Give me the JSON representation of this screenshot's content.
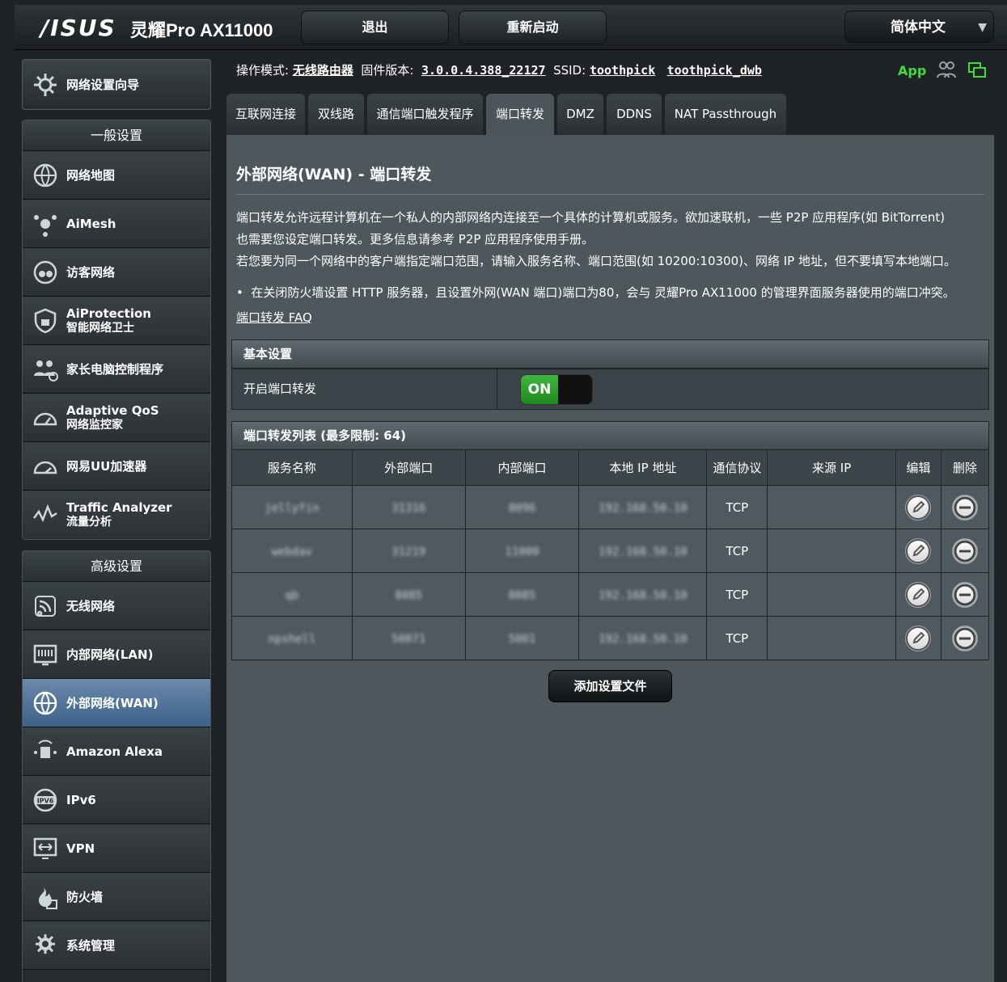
{
  "header": {
    "logo": "/ISUS",
    "model": "灵耀Pro AX11000",
    "logout_label": "退出",
    "reboot_label": "重新启动",
    "language": "简体中文"
  },
  "sidebar": {
    "quick_setup": "网络设置向导",
    "general_title": "一般设置",
    "general_items": [
      {
        "label": "网络地图",
        "sub": ""
      },
      {
        "label": "AiMesh",
        "sub": ""
      },
      {
        "label": "访客网络",
        "sub": ""
      },
      {
        "label": "AiProtection",
        "sub": "智能网络卫士"
      },
      {
        "label": "家长电脑控制程序",
        "sub": ""
      },
      {
        "label": "Adaptive QoS",
        "sub": "网络监控家"
      },
      {
        "label": "网易UU加速器",
        "sub": ""
      },
      {
        "label": "Traffic Analyzer",
        "sub": "流量分析"
      }
    ],
    "advanced_title": "高级设置",
    "advanced_items": [
      {
        "label": "无线网络"
      },
      {
        "label": "内部网络(LAN)"
      },
      {
        "label": "外部网络(WAN)"
      },
      {
        "label": "Amazon Alexa"
      },
      {
        "label": "IPv6"
      },
      {
        "label": "VPN"
      },
      {
        "label": "防火墙"
      },
      {
        "label": "系统管理"
      }
    ]
  },
  "infobar": {
    "mode_label": "操作模式:",
    "mode_value": "无线路由器",
    "fw_label": "固件版本:",
    "fw_value": "3.0.0.4.388_22127",
    "ssid_label": "SSID:",
    "ssid1": "toothpick",
    "ssid2": "toothpick_dwb",
    "app_label": "App"
  },
  "tabs": [
    "互联网连接",
    "双线路",
    "通信端口触发程序",
    "端口转发",
    "DMZ",
    "DDNS",
    "NAT Passthrough"
  ],
  "content": {
    "title": "外部网络(WAN) - 端口转发",
    "desc1": "端口转发允许远程计算机在一个私人的内部网络内连接至一个具体的计算机或服务。欲加速联机，一些 P2P 应用程序(如 BitTorrent)",
    "desc2": "也需要您设定端口转发。更多信息请参考 P2P 应用程序使用手册。",
    "desc3": "若您要为同一个网络中的客户端指定端口范围，请输入服务名称、端口范围(如 10200:10300)、网络 IP 地址，但不要填写本地端口。",
    "bullet": "在关闭防火墙设置 HTTP 服务器，且设置外网(WAN 端口)端口为80，会与 灵耀Pro AX11000 的管理界面服务器使用的端口冲突。",
    "faq": "端口转发 FAQ",
    "basic_title": "基本设置",
    "enable_label": "开启端口转发",
    "toggle_state": "ON",
    "list_title": "端口转发列表 (最多限制: 64)",
    "columns": [
      "服务名称",
      "外部端口",
      "内部端口",
      "本地 IP 地址",
      "通信协议",
      "来源 IP",
      "编辑",
      "删除"
    ],
    "rows": [
      {
        "name": "jellyfin",
        "ext": "31316",
        "int": "8096",
        "ip": "192.168.50.10",
        "proto": "TCP",
        "src": ""
      },
      {
        "name": "webdav",
        "ext": "31219",
        "int": "11000",
        "ip": "192.168.50.10",
        "proto": "TCP",
        "src": ""
      },
      {
        "name": "qb",
        "ext": "8085",
        "int": "8085",
        "ip": "192.168.50.10",
        "proto": "TCP",
        "src": ""
      },
      {
        "name": "npshell",
        "ext": "50071",
        "int": "5001",
        "ip": "192.168.50.10",
        "proto": "TCP",
        "src": ""
      }
    ],
    "add_label": "添加设置文件"
  }
}
